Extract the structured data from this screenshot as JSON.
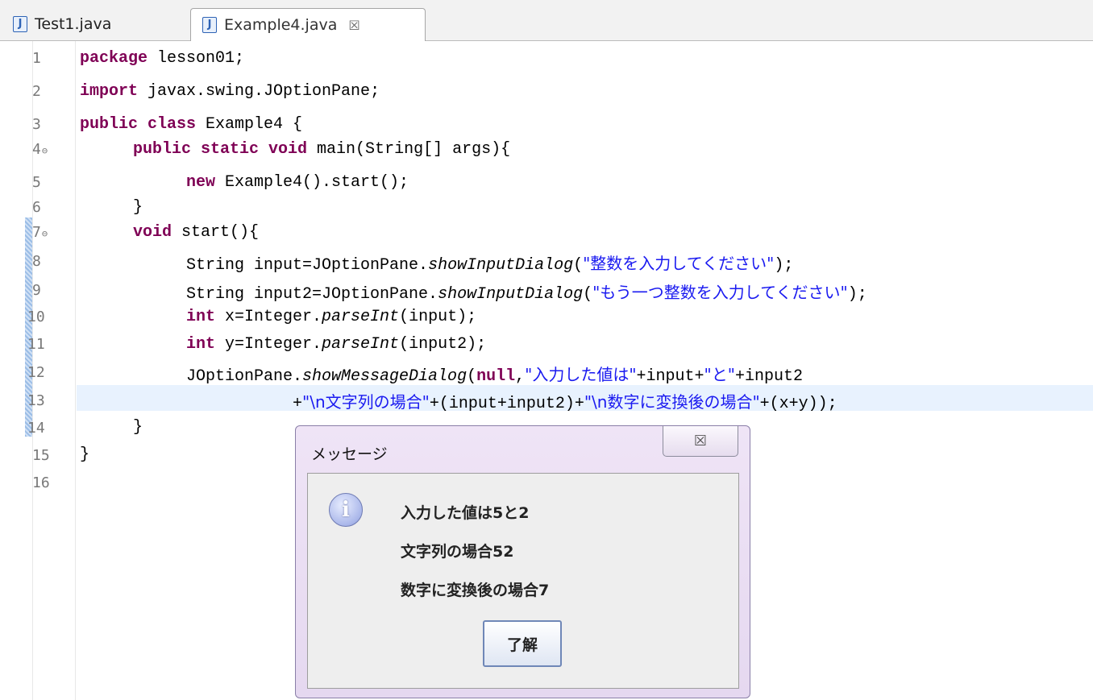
{
  "tabs": [
    {
      "label": "Test1.java",
      "icon": "java-file-icon",
      "active": false
    },
    {
      "label": "Example4.java",
      "icon": "java-file-icon",
      "active": true,
      "close": "☒"
    }
  ],
  "editor": {
    "lines": [
      {
        "num": "1"
      },
      {
        "num": "2"
      },
      {
        "num": "3"
      },
      {
        "num": "4",
        "fold": "⊖"
      },
      {
        "num": "5"
      },
      {
        "num": "6"
      },
      {
        "num": "7",
        "fold": "⊖"
      },
      {
        "num": "8"
      },
      {
        "num": "9"
      },
      {
        "num": "10"
      },
      {
        "num": "11"
      },
      {
        "num": "12"
      },
      {
        "num": "13"
      },
      {
        "num": "14"
      },
      {
        "num": "15"
      },
      {
        "num": "16"
      }
    ],
    "code": {
      "l1_kw": "package",
      "l1_rest": " lesson01;",
      "l2_kw": "import",
      "l2_rest": " javax.swing.JOptionPane;",
      "l3_kw": "public class",
      "l3_rest": " Example4 {",
      "l4_kw": "public static void",
      "l4_rest": " main(String[] args){",
      "l5_kw": "new",
      "l5_rest": " Example4().start();",
      "l6": "}",
      "l7_kw": "void",
      "l7_rest": " start(){",
      "l8_a": "String input=JOptionPane.",
      "l8_it": "showInputDialog",
      "l8_b": "(",
      "l8_str": "\"整数を入力してください\"",
      "l8_c": ");",
      "l9_a": "String input2=JOptionPane.",
      "l9_it": "showInputDialog",
      "l9_b": "(",
      "l9_str": "\"もう一つ整数を入力してください\"",
      "l9_c": ");",
      "l10_kw": "int",
      "l10_a": " x=Integer.",
      "l10_it": "parseInt",
      "l10_b": "(input);",
      "l11_kw": "int",
      "l11_a": " y=Integer.",
      "l11_it": "parseInt",
      "l11_b": "(input2);",
      "l12_a": "JOptionPane.",
      "l12_it": "showMessageDialog",
      "l12_b": "(",
      "l12_kw": "null",
      "l12_c": ",",
      "l12_str1": "\"入力した値は\"",
      "l12_d": "+input+",
      "l12_str2": "\"と\"",
      "l12_e": "+input2",
      "l13_a": "+",
      "l13_str1": "\"\\n文字列の場合\"",
      "l13_b": "+(input+input2)+",
      "l13_str2": "\"\\n数字に変換後の場合\"",
      "l13_c": "+(x+y));",
      "l14": "}",
      "l15": "}"
    }
  },
  "dialog": {
    "title": "メッセージ",
    "close": "☒",
    "icon": "info-icon",
    "icon_glyph": "i",
    "messages": [
      "入力した値は5と2",
      "文字列の場合52",
      "数字に変換後の場合7"
    ],
    "ok_label": "了解"
  },
  "colors": {
    "keyword": "#7f0055",
    "string": "#1a1af0",
    "current_line": "#e8f2fe"
  }
}
